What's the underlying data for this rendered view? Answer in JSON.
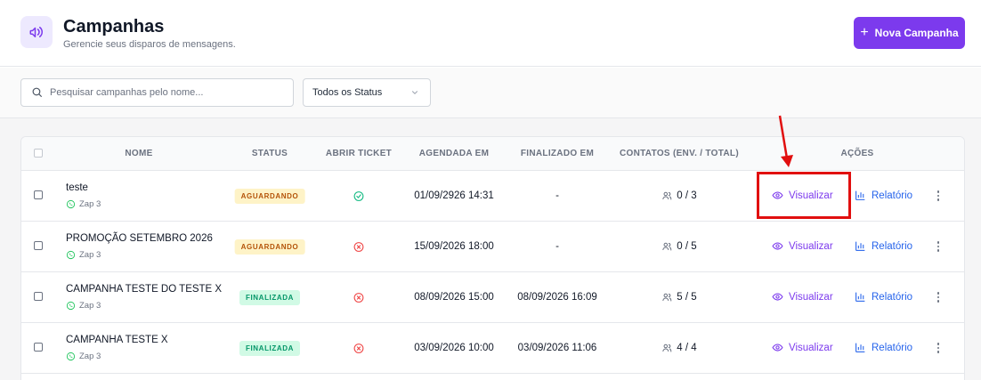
{
  "header": {
    "title": "Campanhas",
    "subtitle": "Gerencie seus disparos de mensagens.",
    "new_button_label": "Nova Campanha",
    "accent_color": "#7c3aed"
  },
  "filters": {
    "search_placeholder": "Pesquisar campanhas pelo nome...",
    "search_value": "",
    "status_selected": "Todos os Status"
  },
  "table": {
    "columns": {
      "name": "NOME",
      "status": "STATUS",
      "ticket": "ABRIR TICKET",
      "scheduled": "AGENDADA EM",
      "finished": "FINALIZADO EM",
      "contacts": "CONTATOS (ENV. / TOTAL)",
      "actions": "AÇÕES"
    },
    "action_labels": {
      "view": "Visualizar",
      "report": "Relatório"
    },
    "rows": [
      {
        "name": "teste",
        "connection": "Zap 3",
        "status": "AGUARDANDO",
        "status_color": "#fef3c7",
        "status_text_color": "#b45309",
        "open_ticket": true,
        "scheduled": "01/09/2926 14:31",
        "finished": "-",
        "contacts": "0 / 3"
      },
      {
        "name": "PROMOÇÃO SETEMBRO 2026",
        "connection": "Zap 3",
        "status": "AGUARDANDO",
        "status_color": "#fef3c7",
        "status_text_color": "#b45309",
        "open_ticket": false,
        "scheduled": "15/09/2026 18:00",
        "finished": "-",
        "contacts": "0 / 5"
      },
      {
        "name": "CAMPANHA TESTE DO TESTE X",
        "connection": "Zap 3",
        "status": "FINALIZADA",
        "status_color": "#d1fae5",
        "status_text_color": "#059669",
        "open_ticket": false,
        "scheduled": "08/09/2026 15:00",
        "finished": "08/09/2026 16:09",
        "contacts": "5 / 5"
      },
      {
        "name": "CAMPANHA TESTE X",
        "connection": "Zap 3",
        "status": "FINALIZADA",
        "status_color": "#d1fae5",
        "status_text_color": "#059669",
        "open_ticket": false,
        "scheduled": "03/09/2026 10:00",
        "finished": "03/09/2026 11:06",
        "contacts": "4 / 4"
      }
    ]
  },
  "icons": {
    "header": "megaphone-icon",
    "search": "search-icon",
    "select": "chevron-down-icon",
    "connection": "whatsapp-icon",
    "ticket_yes": "check-circle-icon",
    "ticket_no": "x-circle-icon",
    "contacts": "users-icon",
    "view": "eye-icon",
    "report": "bar-chart-icon",
    "more": "kebab-menu-icon"
  },
  "annotation": {
    "highlight_color": "#e10f0f"
  }
}
